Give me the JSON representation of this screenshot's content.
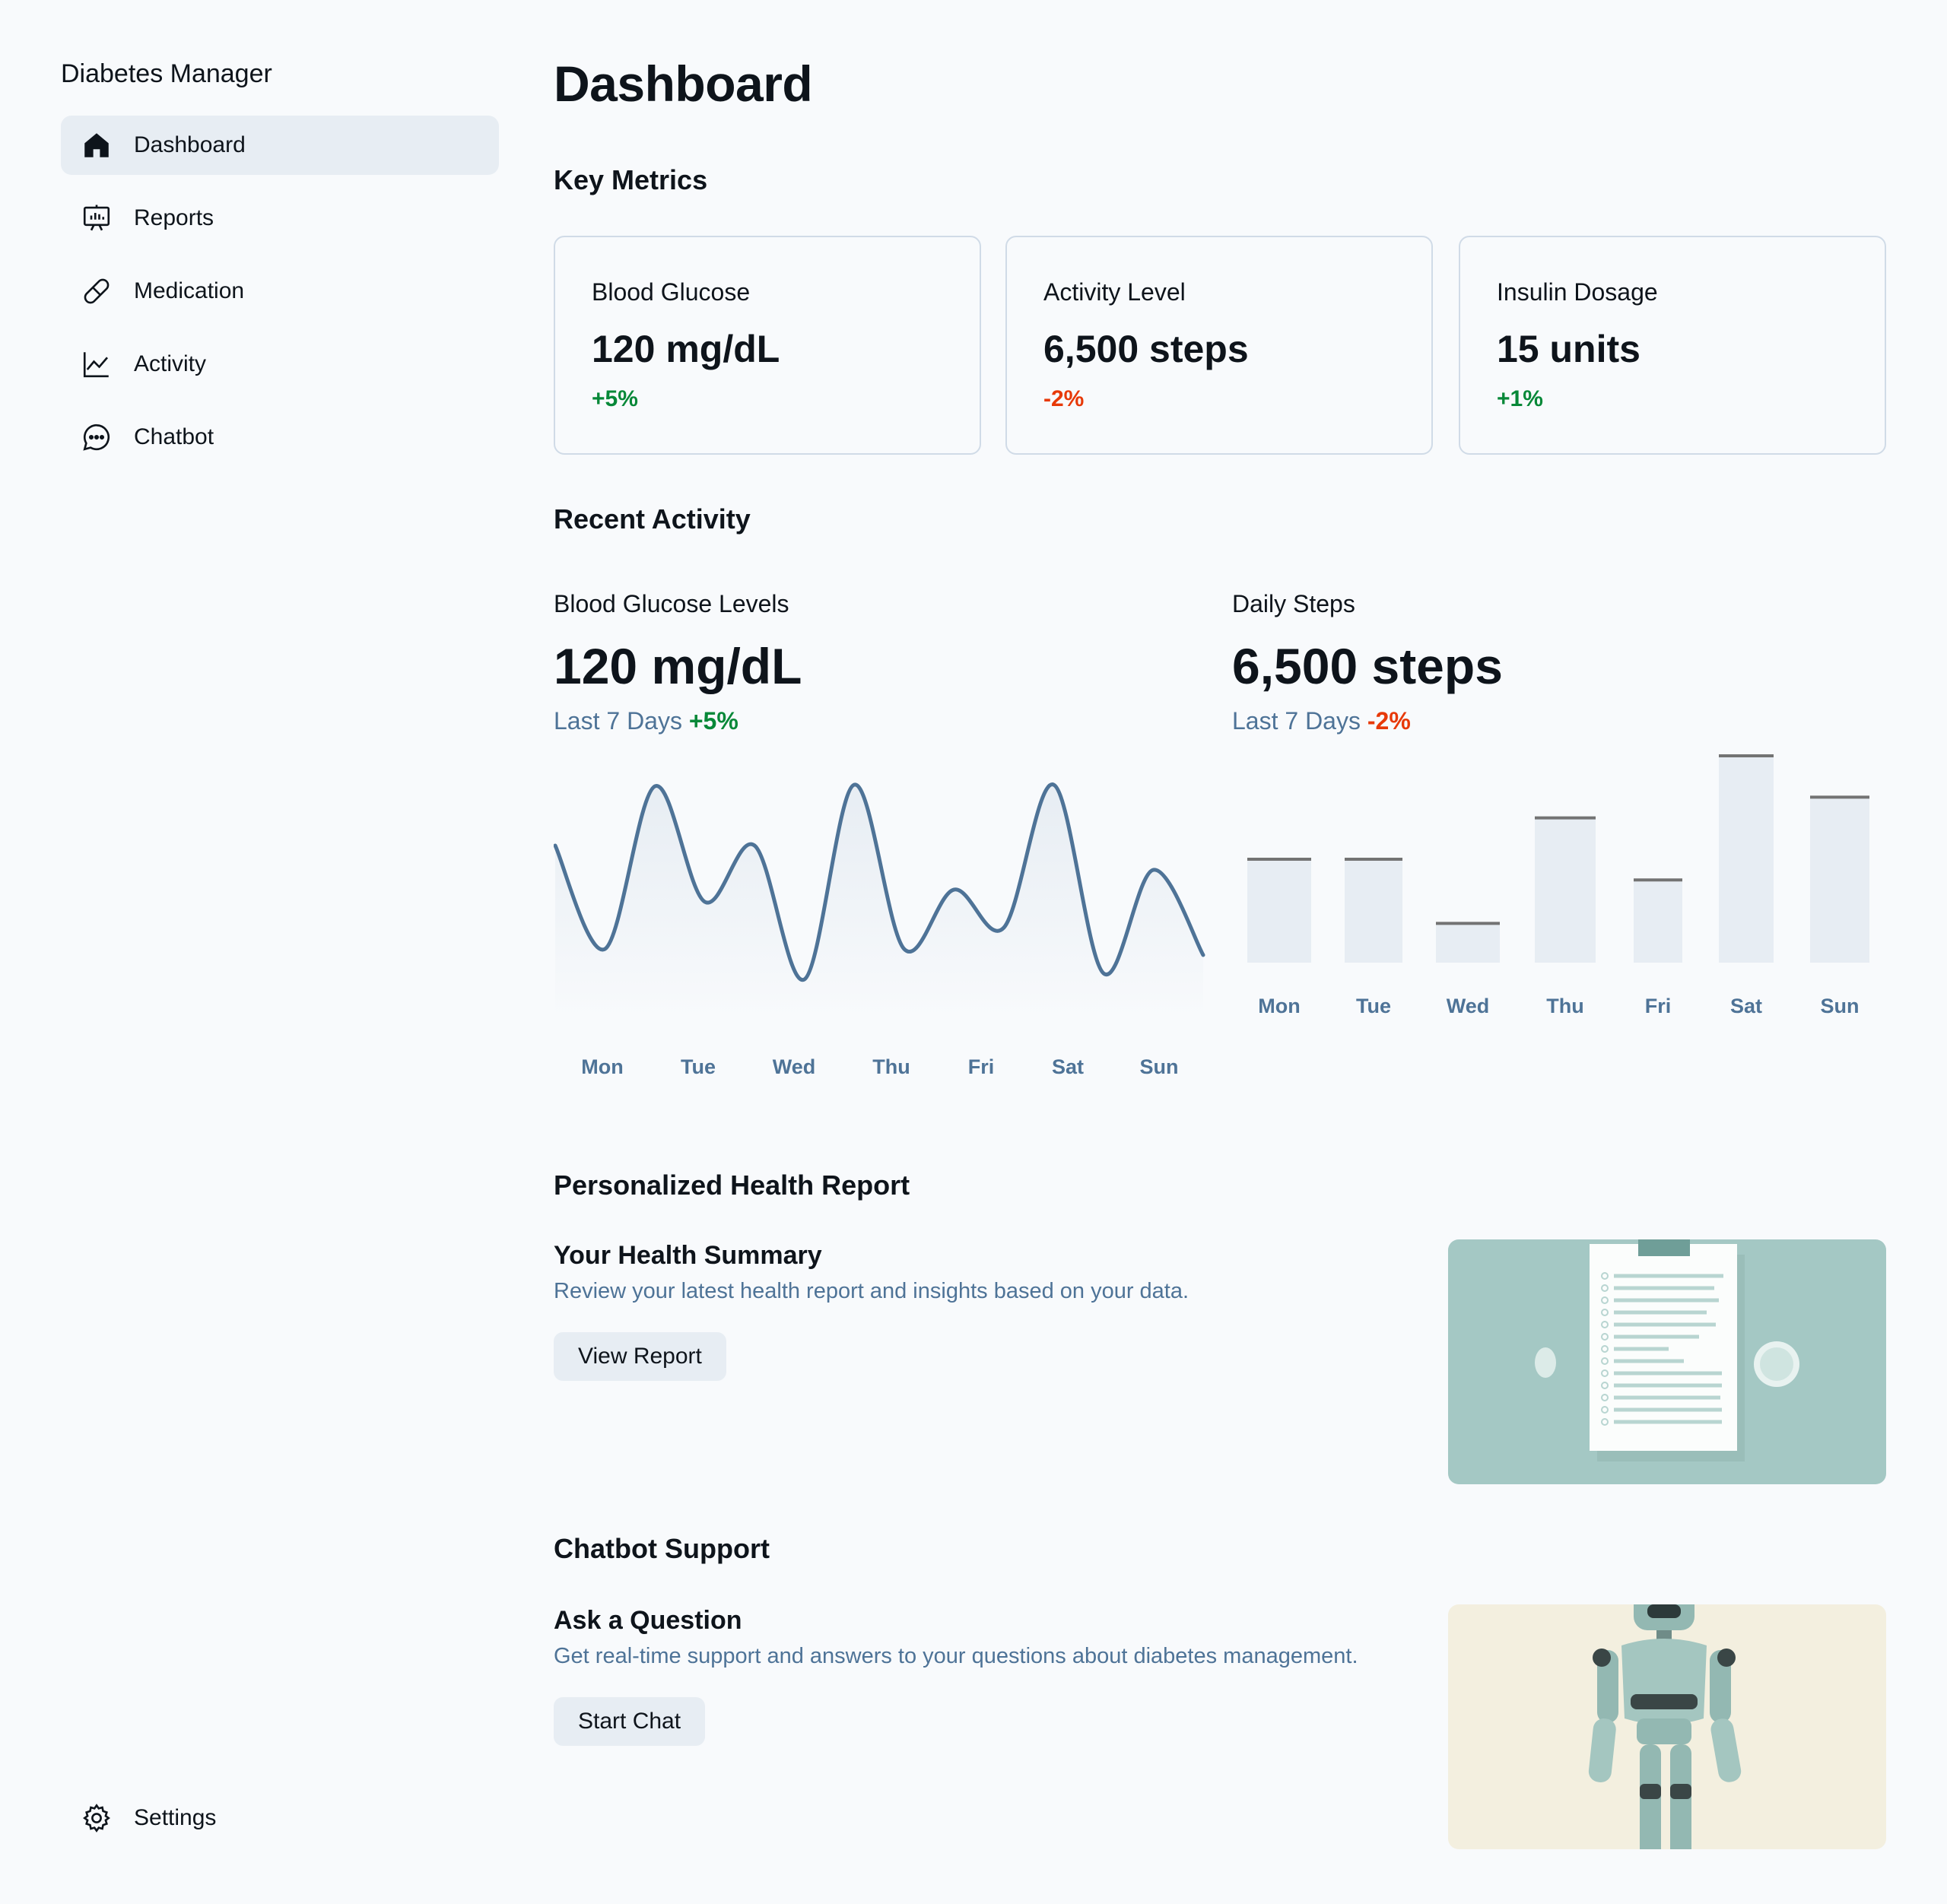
{
  "app": {
    "title": "Diabetes Manager"
  },
  "sidebar": {
    "items": [
      {
        "label": "Dashboard",
        "icon": "home-icon",
        "active": true
      },
      {
        "label": "Reports",
        "icon": "presentation-chart-icon",
        "active": false
      },
      {
        "label": "Medication",
        "icon": "pill-icon",
        "active": false
      },
      {
        "label": "Activity",
        "icon": "line-chart-icon",
        "active": false
      },
      {
        "label": "Chatbot",
        "icon": "chat-bubble-icon",
        "active": false
      }
    ],
    "settings": {
      "label": "Settings",
      "icon": "gear-icon"
    }
  },
  "main": {
    "title": "Dashboard",
    "key_metrics": {
      "heading": "Key Metrics",
      "cards": [
        {
          "label": "Blood Glucose",
          "value": "120 mg/dL",
          "change": "+5%",
          "trend": "up"
        },
        {
          "label": "Activity Level",
          "value": "6,500 steps",
          "change": "-2%",
          "trend": "down"
        },
        {
          "label": "Insulin Dosage",
          "value": "15 units",
          "change": "+1%",
          "trend": "up"
        }
      ]
    },
    "recent_activity": {
      "heading": "Recent Activity",
      "glucose": {
        "label": "Blood Glucose Levels",
        "value": "120 mg/dL",
        "period": "Last 7 Days",
        "change": "+5%"
      },
      "steps": {
        "label": "Daily Steps",
        "value": "6,500 steps",
        "period": "Last 7 Days",
        "change": "-2%"
      }
    },
    "health_report": {
      "heading": "Personalized Health Report",
      "title": "Your Health Summary",
      "description": "Review your latest health report and insights based on your data.",
      "button": "View Report"
    },
    "chatbot": {
      "heading": "Chatbot Support",
      "title": "Ask a Question",
      "description": "Get real-time support and answers to your questions about diabetes management.",
      "button": "Start Chat"
    }
  },
  "colors": {
    "background": "#f8fafc",
    "active_nav": "#e7edf3",
    "positive": "#078838",
    "negative": "#e73908",
    "muted_text": "#4e7397",
    "line": "#4e7397",
    "bar_fill": "#e7edf3",
    "bar_top": "#737373"
  },
  "chart_data": [
    {
      "type": "line",
      "categories": [
        "Mon",
        "Tue",
        "Wed",
        "Thu",
        "Fri",
        "Sat",
        "Sun"
      ],
      "series": [
        {
          "values": [
            109,
            41,
            148,
            72,
            109,
            21,
            149,
            41,
            80,
            55,
            149,
            25,
            93,
            37
          ]
        }
      ]
    },
    {
      "type": "bar",
      "categories": [
        "Mon",
        "Tue",
        "Wed",
        "Thu",
        "Fri",
        "Sat",
        "Sun"
      ],
      "values": [
        50,
        50,
        19,
        70,
        40,
        100,
        80
      ]
    }
  ]
}
